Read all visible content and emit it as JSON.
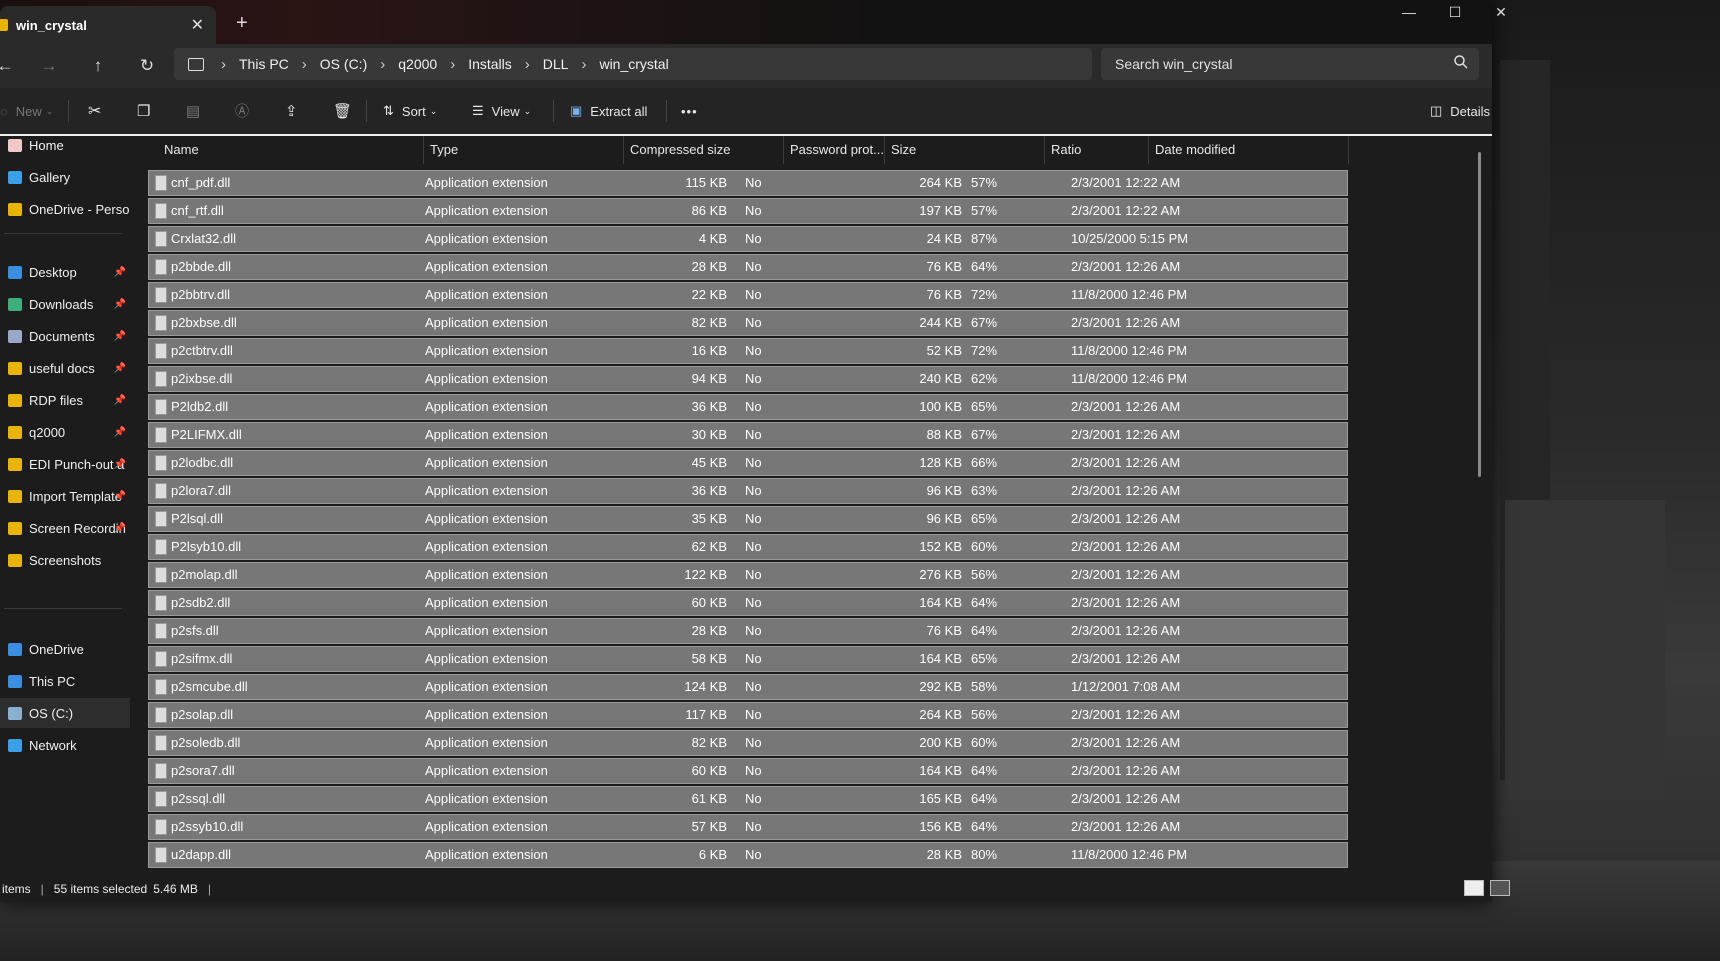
{
  "window": {
    "tab_title": "win_crystal",
    "tab_close": "✕",
    "new_tab": "+",
    "controls": {
      "minimize": "—",
      "maximize": "☐",
      "close": "✕"
    }
  },
  "breadcrumb": [
    "This PC",
    "OS (C:)",
    "q2000",
    "Installs",
    "DLL",
    "win_crystal"
  ],
  "breadcrumb_sep": "›",
  "search": {
    "placeholder": "Search win_crystal"
  },
  "toolbar": {
    "new_label": "New",
    "sort_label": "Sort",
    "view_label": "View",
    "extract_label": "Extract all",
    "more_label": "•••",
    "details_label": "Details"
  },
  "sidebar": {
    "top": [
      {
        "label": "Home",
        "color": "#f0c8c8"
      },
      {
        "label": "Gallery",
        "color": "#3aa0e8"
      },
      {
        "label": "OneDrive - Persona",
        "color": "#e8b400"
      }
    ],
    "pinned": [
      {
        "label": "Desktop",
        "color": "#3a8fe0",
        "pin": "📌"
      },
      {
        "label": "Downloads",
        "color": "#3ab07a",
        "pin": "📌"
      },
      {
        "label": "Documents",
        "color": "#9aa8c8",
        "pin": "📌"
      },
      {
        "label": "useful docs",
        "color": "#e8b400",
        "pin": "📌"
      },
      {
        "label": "RDP files",
        "color": "#e8b400",
        "pin": "📌"
      },
      {
        "label": "q2000",
        "color": "#e8b400",
        "pin": "📌"
      },
      {
        "label": "EDI Punch-out a",
        "color": "#e8b400",
        "pin": "📌"
      },
      {
        "label": "Import Template",
        "color": "#e8b400",
        "pin": "📌"
      },
      {
        "label": "Screen Recordin",
        "color": "#e8b400",
        "pin": "📌"
      },
      {
        "label": "Screenshots",
        "color": "#e8b400",
        "pin": ""
      }
    ],
    "bottom": [
      {
        "label": "OneDrive",
        "color": "#3a8fe0"
      },
      {
        "label": "This PC",
        "color": "#3a8fe0"
      },
      {
        "label": "OS (C:)",
        "color": "#8ab0d0"
      },
      {
        "label": "Network",
        "color": "#3aa0e8"
      }
    ]
  },
  "columns": [
    "Name",
    "Type",
    "Compressed size",
    "Password prot...",
    "Size",
    "Ratio",
    "Date modified"
  ],
  "files": [
    [
      "cnf_pdf.dll",
      "Application extension",
      "115 KB",
      "No",
      "264 KB",
      "57%",
      "2/3/2001 12:22 AM"
    ],
    [
      "cnf_rtf.dll",
      "Application extension",
      "86 KB",
      "No",
      "197 KB",
      "57%",
      "2/3/2001 12:22 AM"
    ],
    [
      "Crxlat32.dll",
      "Application extension",
      "4 KB",
      "No",
      "24 KB",
      "87%",
      "10/25/2000 5:15 PM"
    ],
    [
      "p2bbde.dll",
      "Application extension",
      "28 KB",
      "No",
      "76 KB",
      "64%",
      "2/3/2001 12:26 AM"
    ],
    [
      "p2bbtrv.dll",
      "Application extension",
      "22 KB",
      "No",
      "76 KB",
      "72%",
      "11/8/2000 12:46 PM"
    ],
    [
      "p2bxbse.dll",
      "Application extension",
      "82 KB",
      "No",
      "244 KB",
      "67%",
      "2/3/2001 12:26 AM"
    ],
    [
      "p2ctbtrv.dll",
      "Application extension",
      "16 KB",
      "No",
      "52 KB",
      "72%",
      "11/8/2000 12:46 PM"
    ],
    [
      "p2ixbse.dll",
      "Application extension",
      "94 KB",
      "No",
      "240 KB",
      "62%",
      "11/8/2000 12:46 PM"
    ],
    [
      "P2ldb2.dll",
      "Application extension",
      "36 KB",
      "No",
      "100 KB",
      "65%",
      "2/3/2001 12:26 AM"
    ],
    [
      "P2LIFMX.dll",
      "Application extension",
      "30 KB",
      "No",
      "88 KB",
      "67%",
      "2/3/2001 12:26 AM"
    ],
    [
      "p2lodbc.dll",
      "Application extension",
      "45 KB",
      "No",
      "128 KB",
      "66%",
      "2/3/2001 12:26 AM"
    ],
    [
      "p2lora7.dll",
      "Application extension",
      "36 KB",
      "No",
      "96 KB",
      "63%",
      "2/3/2001 12:26 AM"
    ],
    [
      "P2lsql.dll",
      "Application extension",
      "35 KB",
      "No",
      "96 KB",
      "65%",
      "2/3/2001 12:26 AM"
    ],
    [
      "P2lsyb10.dll",
      "Application extension",
      "62 KB",
      "No",
      "152 KB",
      "60%",
      "2/3/2001 12:26 AM"
    ],
    [
      "p2molap.dll",
      "Application extension",
      "122 KB",
      "No",
      "276 KB",
      "56%",
      "2/3/2001 12:26 AM"
    ],
    [
      "p2sdb2.dll",
      "Application extension",
      "60 KB",
      "No",
      "164 KB",
      "64%",
      "2/3/2001 12:26 AM"
    ],
    [
      "p2sfs.dll",
      "Application extension",
      "28 KB",
      "No",
      "76 KB",
      "64%",
      "2/3/2001 12:26 AM"
    ],
    [
      "p2sifmx.dll",
      "Application extension",
      "58 KB",
      "No",
      "164 KB",
      "65%",
      "2/3/2001 12:26 AM"
    ],
    [
      "p2smcube.dll",
      "Application extension",
      "124 KB",
      "No",
      "292 KB",
      "58%",
      "1/12/2001 7:08 AM"
    ],
    [
      "p2solap.dll",
      "Application extension",
      "117 KB",
      "No",
      "264 KB",
      "56%",
      "2/3/2001 12:26 AM"
    ],
    [
      "p2soledb.dll",
      "Application extension",
      "82 KB",
      "No",
      "200 KB",
      "60%",
      "2/3/2001 12:26 AM"
    ],
    [
      "p2sora7.dll",
      "Application extension",
      "60 KB",
      "No",
      "164 KB",
      "64%",
      "2/3/2001 12:26 AM"
    ],
    [
      "p2ssql.dll",
      "Application extension",
      "61 KB",
      "No",
      "165 KB",
      "64%",
      "2/3/2001 12:26 AM"
    ],
    [
      "p2ssyb10.dll",
      "Application extension",
      "57 KB",
      "No",
      "156 KB",
      "64%",
      "2/3/2001 12:26 AM"
    ],
    [
      "u2dapp.dll",
      "Application extension",
      "6 KB",
      "No",
      "28 KB",
      "80%",
      "11/8/2000 12:46 PM"
    ]
  ],
  "status": {
    "items": "items",
    "selected": "55 items selected",
    "size": "5.46 MB",
    "sep": "|"
  },
  "colors": {
    "row_selected": "#777777",
    "accent_folder": "#e8b400"
  }
}
